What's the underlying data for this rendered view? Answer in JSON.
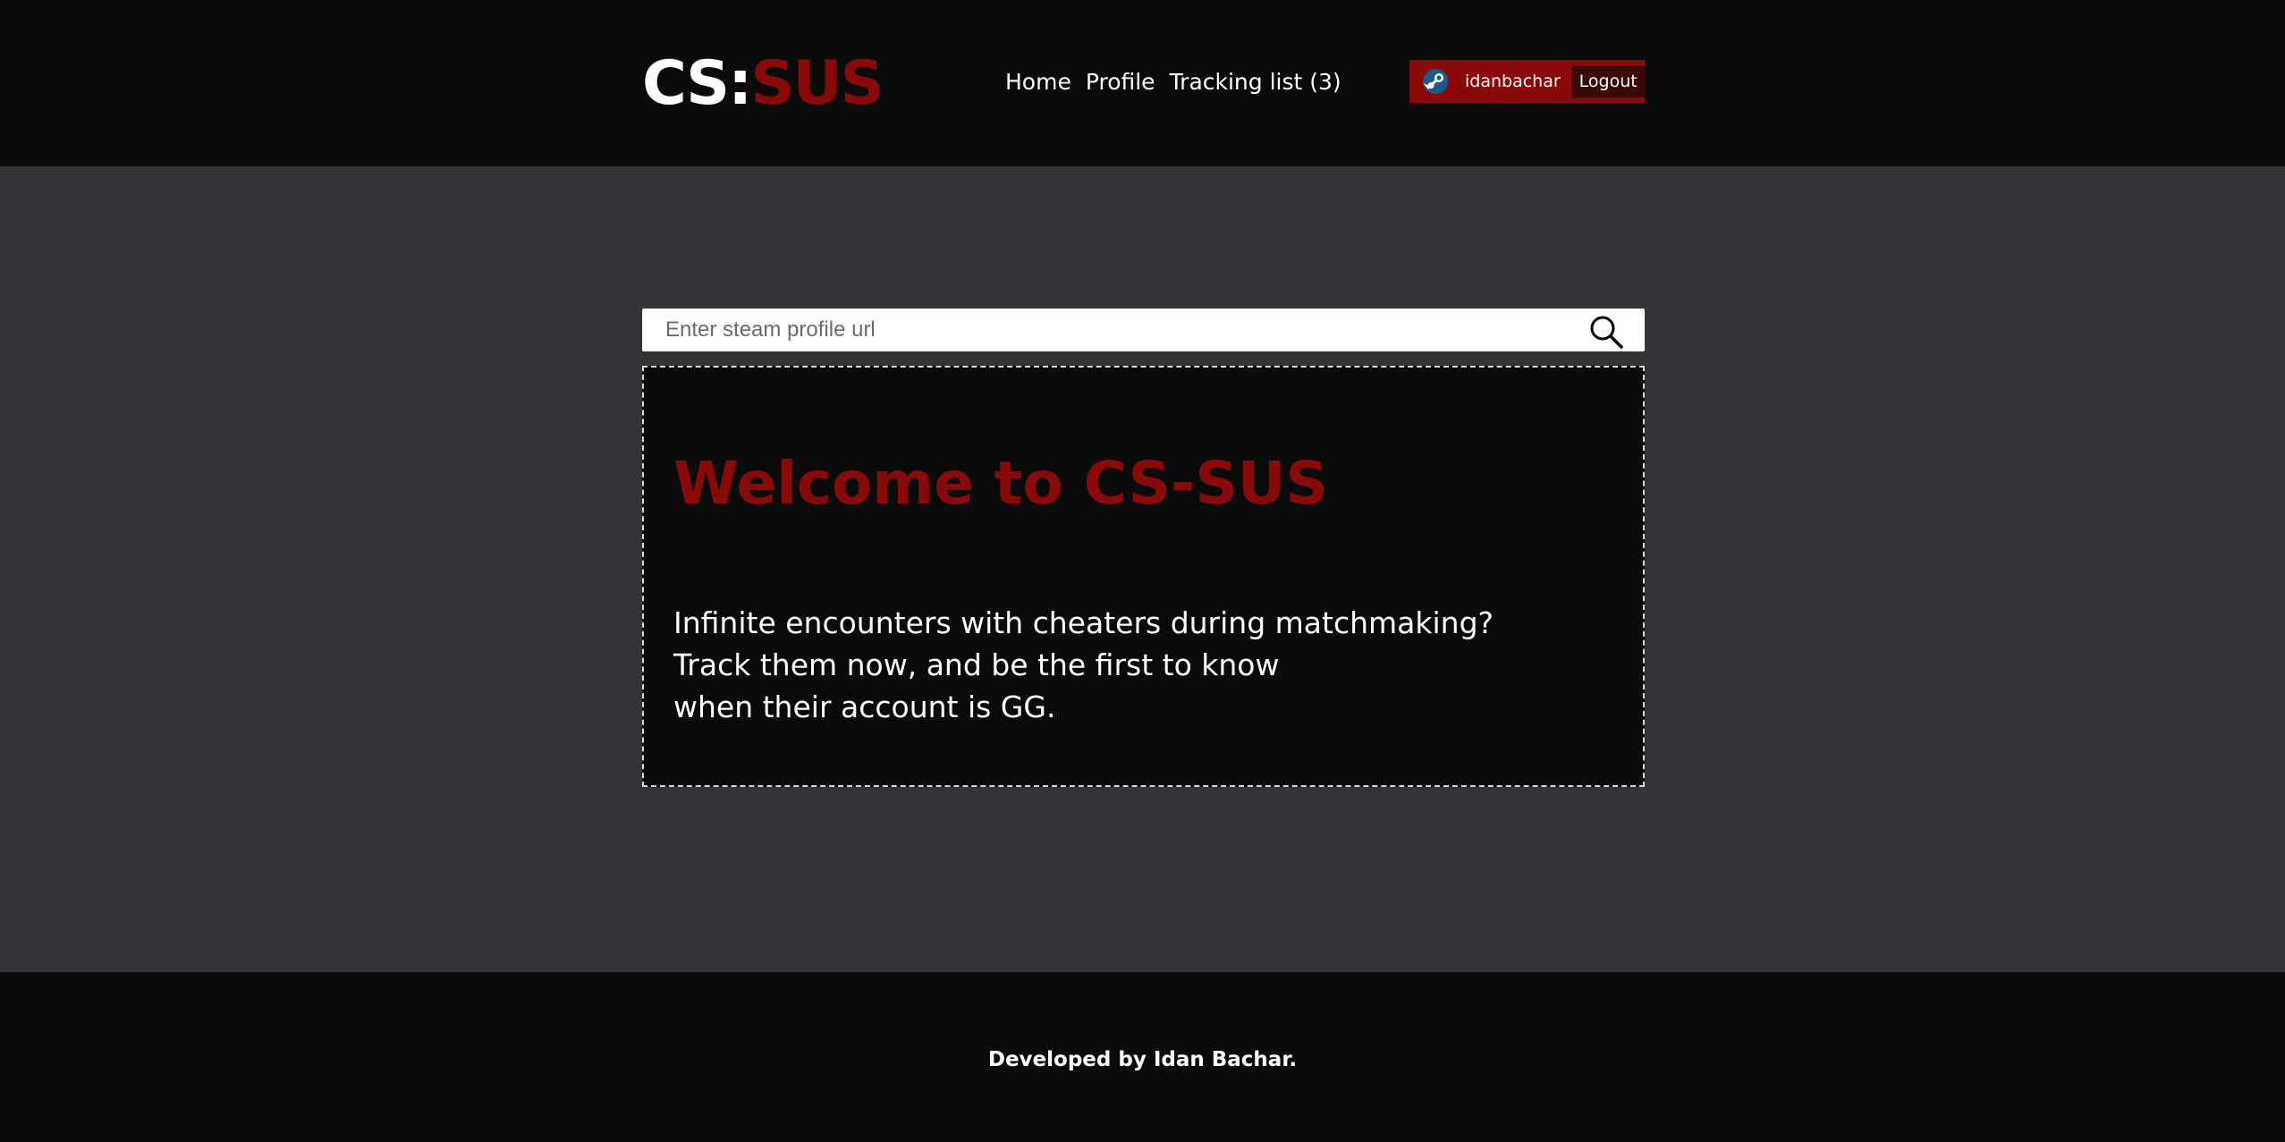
{
  "header": {
    "logo": {
      "part1": "CS:",
      "part2": "SUS"
    },
    "nav": [
      {
        "label": "Home"
      },
      {
        "label": "Profile"
      },
      {
        "label": "Tracking list (3)"
      }
    ],
    "user": {
      "username": "idanbachar",
      "logout_label": "Logout",
      "icon": "steam-icon"
    }
  },
  "search": {
    "placeholder": "Enter steam profile url",
    "value": "",
    "icon": "search-icon"
  },
  "welcome": {
    "title": "Welcome to CS-SUS",
    "lines": [
      "Infinite encounters with cheaters during matchmaking?",
      "Track them now, and be the first to know",
      "when their account is GG."
    ]
  },
  "footer": {
    "text": "Developed by Idan Bachar."
  },
  "colors": {
    "accent": "#8a0a0a",
    "header_bg": "#0b0b0c",
    "page_bg": "#333438",
    "text": "#ffffff"
  }
}
